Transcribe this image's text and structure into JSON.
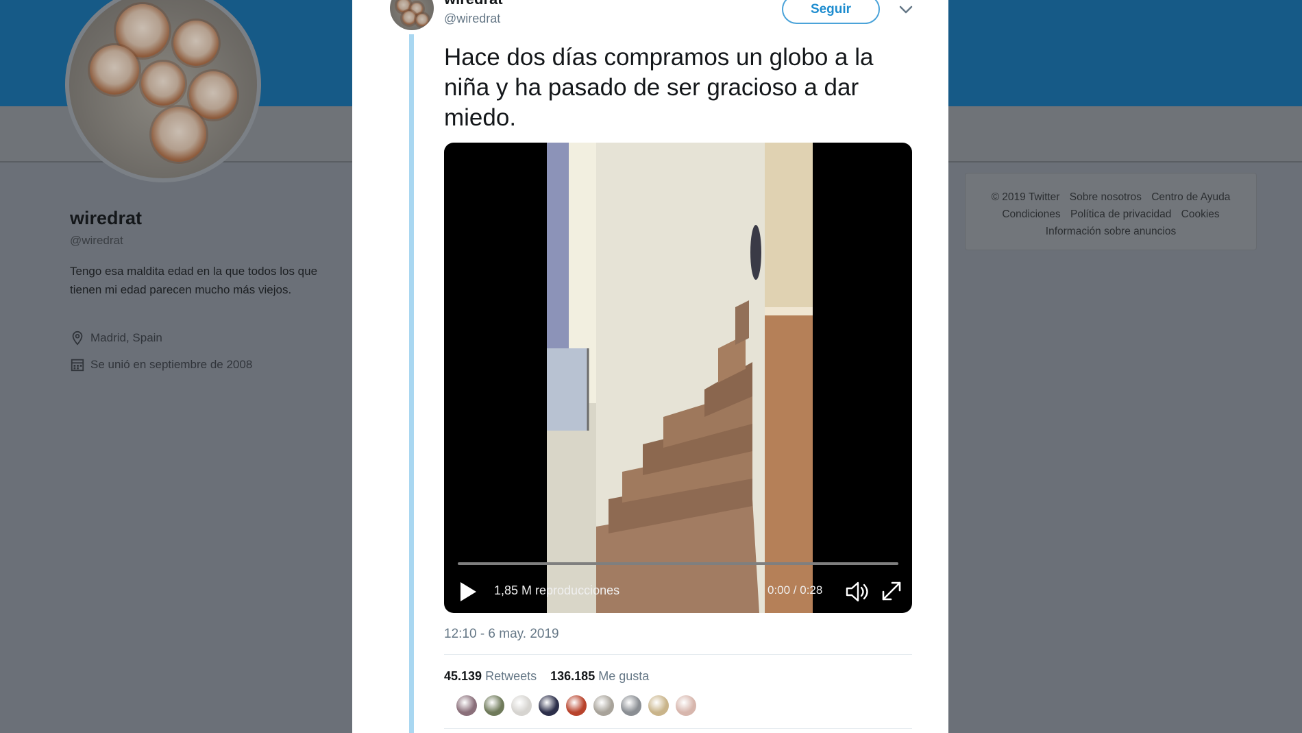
{
  "profile": {
    "name": "wiredrat",
    "handle": "@wiredrat",
    "bio": "Tengo esa maldita edad en la que todos los que tienen mi edad parecen mucho más viejos.",
    "location": "Madrid, Spain",
    "joined": "Se unió en septiembre de 2008"
  },
  "footer": {
    "copyright": "© 2019 Twitter",
    "about": "Sobre nosotros",
    "help": "Centro de Ayuda",
    "terms": "Condiciones",
    "privacy": "Política de privacidad",
    "cookies": "Cookies",
    "ads_info": "Información sobre anuncios"
  },
  "tweet": {
    "author_name": "wiredrat",
    "author_handle": "@wiredrat",
    "follow_label": "Seguir",
    "text": "Hace dos días compramos un globo a la niña y ha pasado de ser gracioso a dar miedo.",
    "video": {
      "views": "1,85 M reproducciones",
      "time": "0:00 / 0:28",
      "progress": 0
    },
    "timestamp": "12:10 - 6 may. 2019",
    "retweets_count": "45.139",
    "retweets_label": "Retweets",
    "likes_count": "136.185",
    "likes_label": "Me gusta",
    "liker_colors": [
      "#8a6f7a",
      "#6f7a5a",
      "#d6d4d0",
      "#2c2f4a",
      "#b8432c",
      "#a8a39a",
      "#8a8e93",
      "#c9b48a",
      "#d7b6ad"
    ]
  },
  "colors": {
    "header_blue": "#165a87",
    "link_blue": "#1d8ccf",
    "thread_line": "#a9d7f1"
  }
}
